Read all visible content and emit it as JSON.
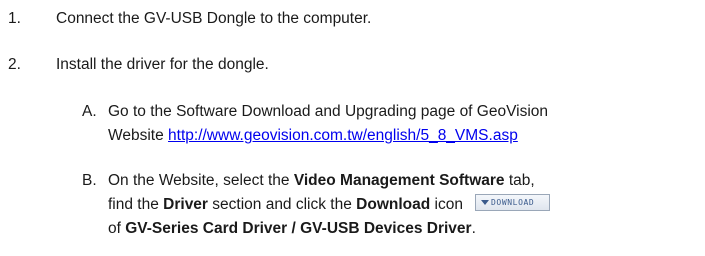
{
  "steps": [
    {
      "number": "1.",
      "text": "Connect the GV-USB Dongle to the computer."
    },
    {
      "number": "2.",
      "text": "Install the driver for the dongle."
    }
  ],
  "substeps": {
    "a": {
      "letter": "A.",
      "line1": "Go to the Software Download and Upgrading page of GeoVision",
      "line2_prefix": "Website ",
      "url": "http://www.geovision.com.tw/english/5_8_VMS.asp"
    },
    "b": {
      "letter": "B.",
      "p1": "On the Website, select the ",
      "b1": "Video Management Software",
      "p2": " tab,",
      "p3": "find the ",
      "b2": "Driver",
      "p4": " section and click the ",
      "b3": "Download",
      "p5": " icon",
      "p6": "of ",
      "b4": "GV-Series Card Driver / GV-USB Devices Driver",
      "p7": "."
    }
  },
  "download_button": {
    "label": "DOWNLOAD",
    "icon": "down-arrow-icon"
  }
}
